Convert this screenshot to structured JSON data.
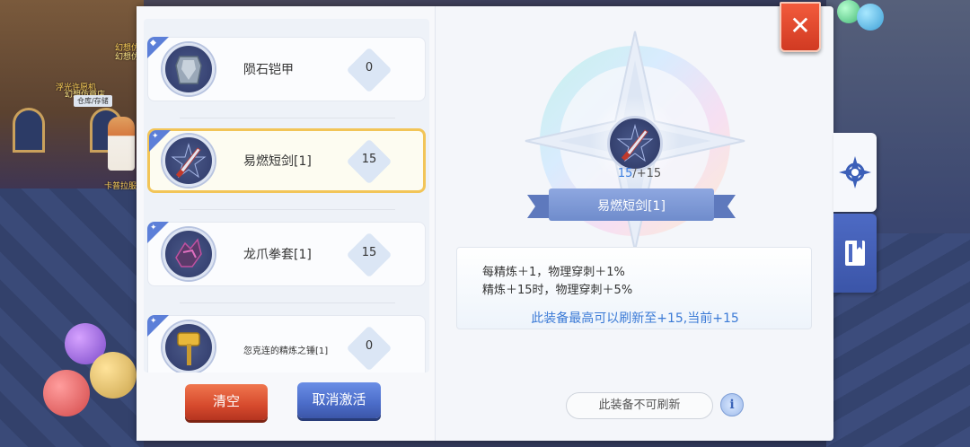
{
  "scene": {
    "npc1_title": "幻想仿",
    "npc1_sub": "幻想仿",
    "npc2_title": "浮光许愿机",
    "npc2_sub": "幻想仿商店",
    "npc_tag": "仓库/存储",
    "npc3_name": "卡普拉服务"
  },
  "equip_list": [
    {
      "name": "陨石铠甲",
      "level": "0",
      "selected": false
    },
    {
      "name": "易燃短剑[1]",
      "level": "15",
      "selected": true
    },
    {
      "name": "龙爪拳套[1]",
      "level": "15",
      "selected": false
    },
    {
      "name": "忽克连的精炼之锤[1]",
      "level": "0",
      "selected": false
    }
  ],
  "buttons": {
    "clear": "清空",
    "cancel_activate": "取消激活"
  },
  "detail": {
    "refine_current": "15",
    "refine_max": "/+15",
    "item_name": "易燃短剑[1]",
    "effect_line1": "每精炼＋1，物理穿刺＋1%",
    "effect_line2": "精炼＋15时，物理穿刺＋5%",
    "max_refresh": "此装备最高可以刷新至+15,当前+15",
    "status": "此装备不可刷新",
    "info": "i"
  },
  "close_label": "✕",
  "colors": {
    "selected_border": "#f2c558",
    "clear_button": "#d64a2d",
    "cancel_button": "#4b6cc8",
    "accent_text": "#3b7ad6",
    "close_button": "#d13a22"
  }
}
